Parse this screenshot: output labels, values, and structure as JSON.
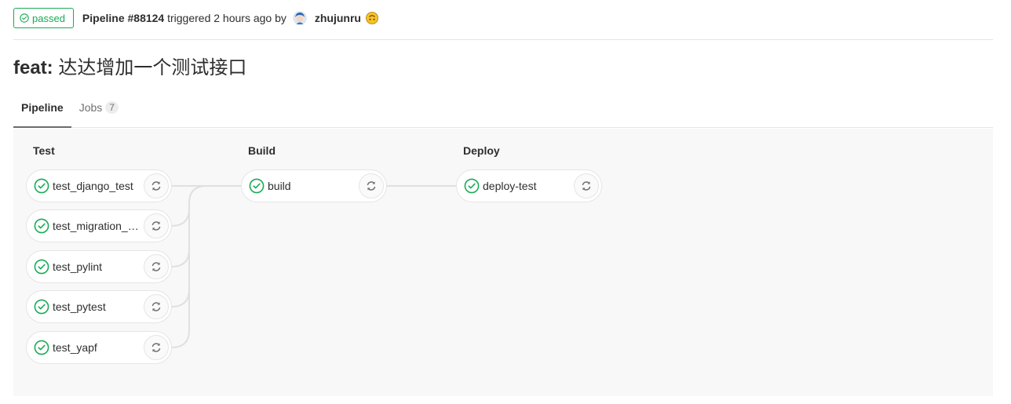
{
  "header": {
    "status": "passed",
    "pipeline_id": "Pipeline #88124",
    "triggered": "triggered 2 hours ago by",
    "author": "zhujunru"
  },
  "title": {
    "prefix": "feat:",
    "text": "达达增加一个测试接口"
  },
  "tabs": [
    {
      "label": "Pipeline"
    },
    {
      "label": "Jobs",
      "count": "7"
    }
  ],
  "stages": [
    {
      "name": "Test",
      "jobs": [
        "test_django_test",
        "test_migration_f...",
        "test_pylint",
        "test_pytest",
        "test_yapf"
      ]
    },
    {
      "name": "Build",
      "jobs": [
        "build"
      ]
    },
    {
      "name": "Deploy",
      "jobs": [
        "deploy-test"
      ]
    }
  ],
  "colors": {
    "success": "#1aaa55",
    "border": "#e5e5e5",
    "graph_bg": "#f8f8f8"
  },
  "icons": {
    "status": "check-circle-icon",
    "retry": "retry-icon"
  }
}
